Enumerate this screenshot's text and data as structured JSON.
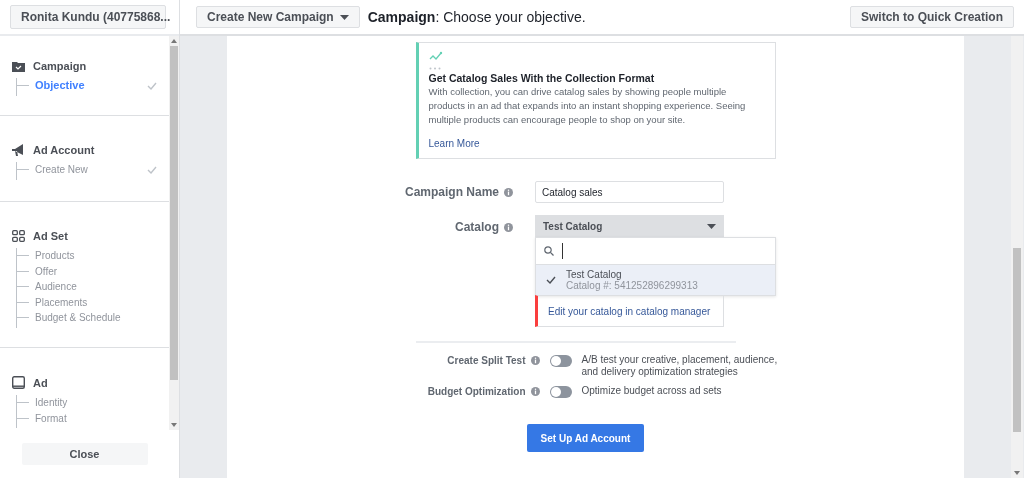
{
  "account_selector": "Ronita Kundu (40775868...",
  "sidebar": {
    "sections": [
      {
        "kind": "campaign",
        "title": "Campaign",
        "items": [
          {
            "label": "Objective",
            "selected": true,
            "done": true
          }
        ]
      },
      {
        "kind": "account",
        "title": "Ad Account",
        "items": [
          {
            "label": "Create New",
            "selected": false,
            "done": true
          }
        ]
      },
      {
        "kind": "adset",
        "title": "Ad Set",
        "items": [
          {
            "label": "Products",
            "selected": false,
            "done": false
          },
          {
            "label": "Offer",
            "selected": false,
            "done": false
          },
          {
            "label": "Audience",
            "selected": false,
            "done": false
          },
          {
            "label": "Placements",
            "selected": false,
            "done": false
          },
          {
            "label": "Budget & Schedule",
            "selected": false,
            "done": false
          }
        ]
      },
      {
        "kind": "ad",
        "title": "Ad",
        "items": [
          {
            "label": "Identity",
            "selected": false,
            "done": false
          },
          {
            "label": "Format",
            "selected": false,
            "done": false
          }
        ]
      }
    ],
    "close_button": "Close"
  },
  "toolbar": {
    "create_button": "Create New Campaign",
    "title": "**Campaign**: Choose your objective.",
    "switch_button": "Switch to Quick Creation"
  },
  "info_card": {
    "title": "Get Catalog Sales With the Collection Format",
    "body": "With collection, you can drive catalog sales by showing people multiple products in an ad that expands into an instant shopping experience. Seeing multiple products can encourage people to shop on your site.",
    "link": "Learn More"
  },
  "form": {
    "campaign_name": {
      "label": "Campaign Name",
      "value": "Catalog sales"
    },
    "catalog": {
      "label": "Catalog",
      "value": "Test Catalog",
      "expanded": true,
      "options": [
        {
          "name": "Test Catalog",
          "detail": "Catalog #: 541252896299313",
          "selected": true
        }
      ],
      "footer_link": "Edit your catalog in catalog manager"
    },
    "toggles": [
      {
        "label": "Create Split Test",
        "description": "A/B test your creative, placement, audience, and delivery optimization strategies",
        "on": false
      },
      {
        "label": "Budget Optimization",
        "description": "Optimize budget across ad sets",
        "on": false
      }
    ],
    "submit": "Set Up Ad Account"
  }
}
